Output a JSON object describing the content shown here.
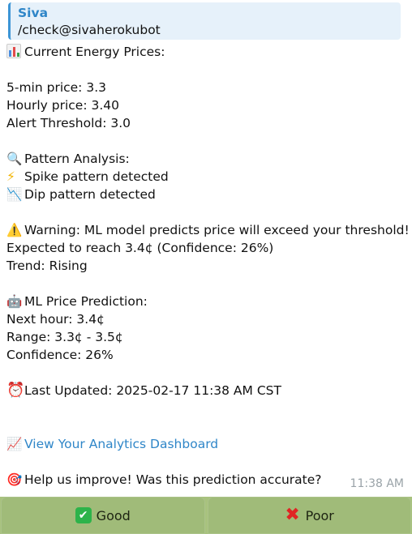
{
  "reply": {
    "sender": "Siva",
    "text": "/check@sivaherokubot"
  },
  "message": {
    "prices_header": "Current Energy Prices:",
    "price_5min": "5-min price: 3.3",
    "price_hourly": "Hourly price: 3.40",
    "alert_threshold": "Alert Threshold: 3.0",
    "pattern_header": "Pattern Analysis:",
    "spike_pattern": "Spike pattern detected",
    "dip_pattern": "Dip pattern detected",
    "warning": "Warning: ML model predicts price will exceed your threshold!",
    "expected": "Expected to reach 3.4¢ (Confidence: 26%)",
    "trend": "Trend: Rising",
    "prediction_header": "ML Price Prediction:",
    "next_hour": "Next hour: 3.4¢",
    "range": "Range: 3.3¢ - 3.5¢",
    "confidence": "Confidence: 26%",
    "last_updated": "Last Updated: 2025-02-17 11:38 AM CST",
    "dashboard_link": "View Your Analytics Dashboard",
    "feedback_question": "Help us improve! Was this prediction accurate?",
    "time": "11:38 AM"
  },
  "icons": {
    "chart": "bar-chart-icon",
    "magnifier": "magnifier-icon",
    "lightning": "lightning-icon",
    "chart_down": "chart-decreasing-icon",
    "warning": "warning-icon",
    "robot": "robot-icon",
    "alarm": "alarm-clock-icon",
    "chart_up": "chart-increasing-icon",
    "target": "dart-target-icon"
  },
  "keyboard": {
    "good_label": "Good",
    "poor_label": "Poor"
  },
  "colors": {
    "link": "#2f86c8",
    "keyboard_bg": "#a0bb79",
    "reply_bar": "#3c95d6"
  }
}
